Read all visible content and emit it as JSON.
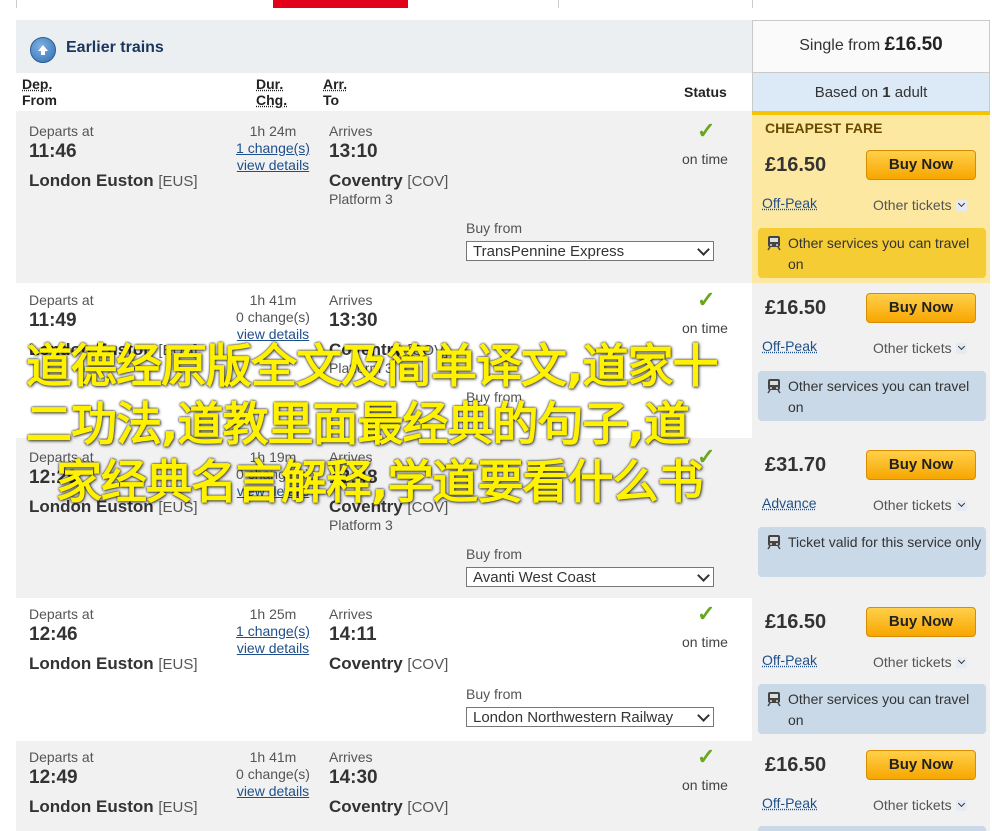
{
  "earlier_trains_label": "Earlier trains",
  "summary": {
    "prefix": "Single from",
    "price": "£16.50",
    "based_on_prefix": "Based on",
    "adults": "1",
    "based_on_suffix": "adult"
  },
  "headers": {
    "dep": "Dep.",
    "from": "From",
    "dur": "Dur.",
    "chg": "Chg.",
    "arr": "Arr.",
    "to": "To",
    "status": "Status"
  },
  "labels": {
    "departs_at": "Departs at",
    "arrives": "Arrives",
    "on_time": "on time",
    "buy_from": "Buy from",
    "view_details": "view details",
    "buy_now": "Buy Now",
    "other_tickets": "Other tickets",
    "cheapest_fare": "CHEAPEST FARE",
    "check_mark": "✓"
  },
  "journeys": [
    {
      "depart": "11:46",
      "from": "London Euston",
      "from_code": "[EUS]",
      "duration": "1h 24m",
      "changes": "1 change(s)",
      "arrive": "13:10",
      "to": "Coventry",
      "to_code": "[COV]",
      "platform": "Platform 3",
      "operator": "TransPennine Express",
      "price": "£16.50",
      "ticket_type": "Off-Peak",
      "info": "Other services you can travel on"
    },
    {
      "depart": "11:49",
      "from": "London Euston",
      "from_code": "[EUS]",
      "duration": "1h 41m",
      "changes": "0 change(s)",
      "arrive": "13:30",
      "to": "Coventry",
      "to_code": "[COV]",
      "platform": "Platform 3",
      "operator": "",
      "price": "£16.50",
      "ticket_type": "Off-Peak",
      "info": "Other services you can travel on"
    },
    {
      "depart": "12:29",
      "from": "London Euston",
      "from_code": "[EUS]",
      "duration": "1h 19m",
      "changes": "0 change(s)",
      "arrive": "13:48",
      "to": "Coventry",
      "to_code": "[COV]",
      "platform": "Platform 3",
      "operator": "Avanti West Coast",
      "price": "£31.70",
      "ticket_type": "Advance",
      "info": "Ticket valid for this service only"
    },
    {
      "depart": "12:46",
      "from": "London Euston",
      "from_code": "[EUS]",
      "duration": "1h 25m",
      "changes": "1 change(s)",
      "arrive": "14:11",
      "to": "Coventry",
      "to_code": "[COV]",
      "platform": "",
      "operator": "London Northwestern Railway",
      "price": "£16.50",
      "ticket_type": "Off-Peak",
      "info": "Other services you can travel on"
    },
    {
      "depart": "12:49",
      "from": "London Euston",
      "from_code": "[EUS]",
      "duration": "1h 41m",
      "changes": "0 change(s)",
      "arrive": "14:30",
      "to": "Coventry",
      "to_code": "[COV]",
      "platform": "",
      "operator": "",
      "price": "£16.50",
      "ticket_type": "Off-Peak",
      "info": ""
    }
  ],
  "overlay": {
    "line1": "道德经原版全文及简单译文,道家十",
    "line2": "二功法,道教里面最经典的句子,道",
    "line3": "家经典名言解释,学道要看什么书"
  },
  "colors": {
    "brand_red": "#e2001a",
    "accent_yellow": "#f5c400",
    "buy_orange": "#f7a600",
    "overlay_text": "#fff200",
    "check_green": "#69a81e"
  }
}
